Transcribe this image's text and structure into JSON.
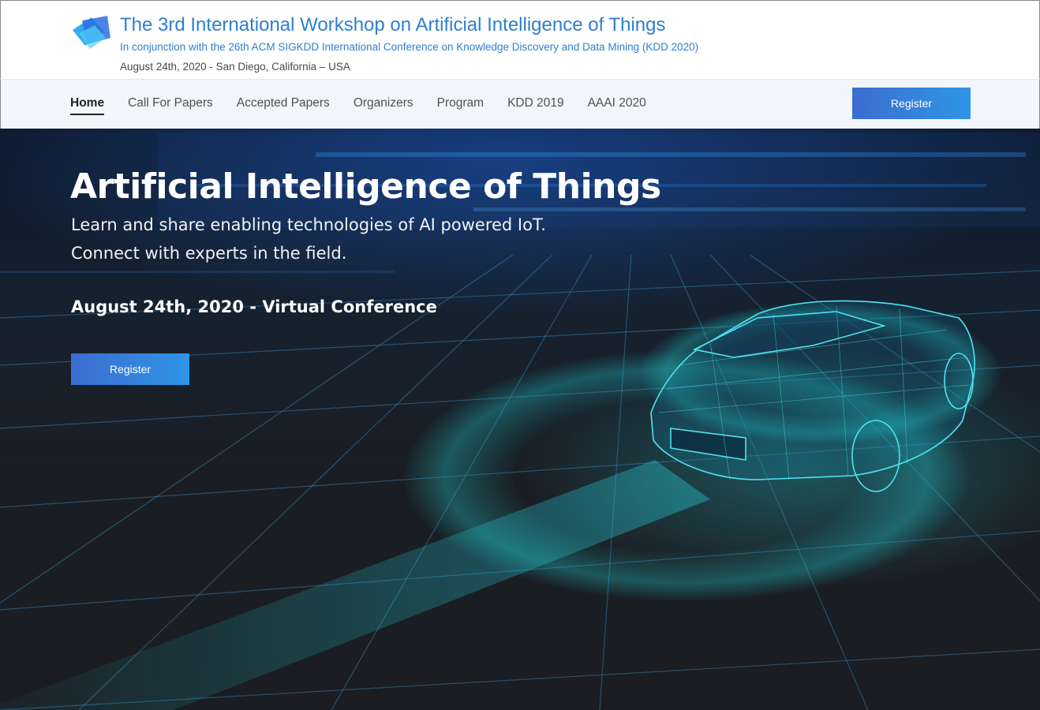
{
  "header": {
    "title": "The 3rd International Workshop on Artificial Intelligence of Things",
    "subtitle": "In conjunction with the 26th ACM SIGKDD International Conference on Knowledge Discovery and Data Mining (KDD 2020)",
    "date_location": "August 24th, 2020 - San Diego, California – USA",
    "logo_icon": "layered-squares-logo-icon"
  },
  "nav": {
    "items": [
      {
        "label": "Home",
        "active": true
      },
      {
        "label": "Call For Papers",
        "active": false
      },
      {
        "label": "Accepted Papers",
        "active": false
      },
      {
        "label": "Organizers",
        "active": false
      },
      {
        "label": "Program",
        "active": false
      },
      {
        "label": "KDD 2019",
        "active": false
      },
      {
        "label": "AAAI 2020",
        "active": false
      }
    ],
    "register_label": "Register"
  },
  "hero": {
    "title": "Artificial Intelligence of Things",
    "line1": "Learn and share enabling technologies of AI powered IoT.",
    "line2": "Connect with experts in the field.",
    "date": "August 24th, 2020 - Virtual Conference",
    "register_label": "Register",
    "background_image": "wireframe-car-on-digital-grid"
  },
  "colors": {
    "brand_blue": "#2f7fce",
    "button_gradient_start": "#3c6dd1",
    "button_gradient_end": "#2f95e6",
    "nav_background": "#f2f5f9",
    "hero_background": "#1b1e23"
  }
}
